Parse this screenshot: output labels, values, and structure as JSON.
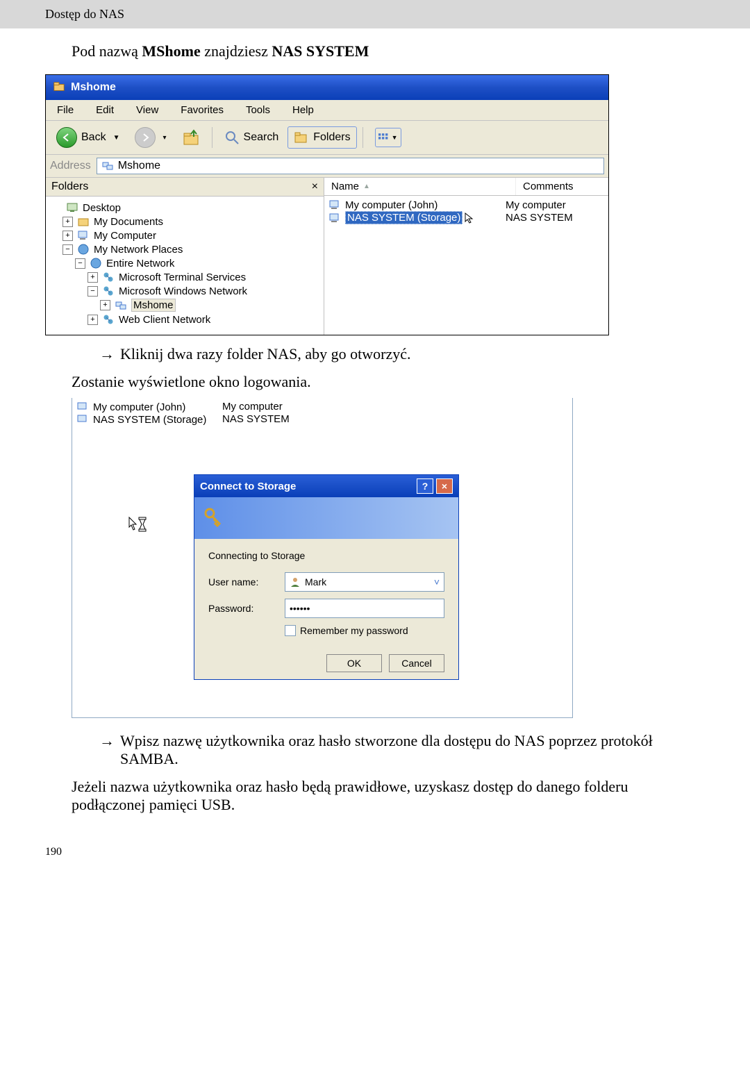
{
  "doc": {
    "header": "Dostęp do NAS",
    "line1_pre": "Pod nazwą ",
    "line1_bold1": "MShome",
    "line1_mid": " znajdziesz ",
    "line1_bold2": "NAS SYSTEM",
    "instr1_arrow": "→",
    "instr1": "Kliknij dwa razy folder NAS, aby go otworzyć.",
    "instr2": "Zostanie wyświetlone okno logowania.",
    "instr3_arrow": "→",
    "instr3": "Wpisz nazwę użytkownika oraz hasło stworzone dla dostępu do NAS poprzez protokół SAMBA.",
    "instr4": "Jeżeli nazwa użytkownika oraz hasło będą prawidłowe, uzyskasz dostęp do danego folderu podłączonej pamięci USB.",
    "page_number": "190"
  },
  "explorer": {
    "title": "Mshome",
    "menu": {
      "file": "File",
      "edit": "Edit",
      "view": "View",
      "favorites": "Favorites",
      "tools": "Tools",
      "help": "Help"
    },
    "toolbar": {
      "back": "Back",
      "search": "Search",
      "folders": "Folders"
    },
    "address_label": "Address",
    "address_value": "Mshome",
    "folders_panel_title": "Folders",
    "close_x": "×",
    "tree": {
      "desktop": "Desktop",
      "my_documents": "My Documents",
      "my_computer": "My Computer",
      "my_network_places": "My Network Places",
      "entire_network": "Entire Network",
      "ms_terminal": "Microsoft Terminal Services",
      "ms_windows_net": "Microsoft Windows Network",
      "mshome": "Mshome",
      "web_client": "Web Client Network"
    },
    "columns": {
      "name": "Name",
      "comments": "Comments"
    },
    "rows": [
      {
        "name": "My computer (John)",
        "comment": "My computer"
      },
      {
        "name": "NAS SYSTEM (Storage)",
        "comment": "NAS SYSTEM"
      }
    ]
  },
  "sc2": {
    "rows": [
      {
        "name": "My computer (John)",
        "comment": "My computer"
      },
      {
        "name": "NAS SYSTEM (Storage)",
        "comment": "NAS SYSTEM"
      }
    ]
  },
  "dialog": {
    "title": "Connect to Storage",
    "help": "?",
    "close": "×",
    "status": "Connecting to Storage",
    "username_label": "User name:",
    "username_value": "Mark",
    "password_label": "Password:",
    "password_value": "••••••",
    "remember": "Remember my password",
    "ok": "OK",
    "cancel": "Cancel"
  }
}
